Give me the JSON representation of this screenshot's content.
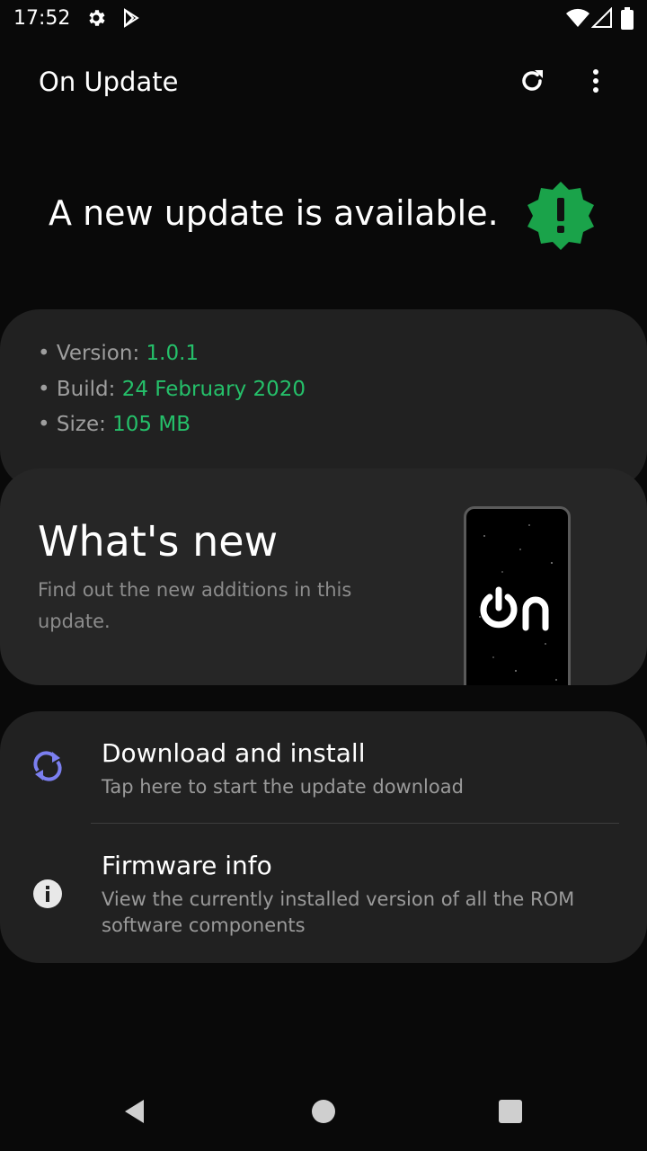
{
  "status_bar": {
    "time": "17:52",
    "icons": [
      "gear-icon",
      "play-store-icon",
      "wifi-icon",
      "signal-icon",
      "battery-icon"
    ]
  },
  "app_bar": {
    "title": "On Update",
    "actions": [
      "refresh-icon",
      "more-vert-icon"
    ]
  },
  "hero": {
    "message": "A new update is available.",
    "badge_icon": "alert-badge-icon",
    "badge_color": "#1aa34a"
  },
  "info": {
    "version_label": "• Version: ",
    "version_value": "1.0.1",
    "build_label": "• Build: ",
    "build_value": "24 February 2020",
    "size_label": "• Size: ",
    "size_value": "105 MB",
    "accent_color": "#25c06a"
  },
  "whats_new": {
    "title": "What's new",
    "description": "Find out the new additions in this update.",
    "logo_icon": "on-logo-icon"
  },
  "actions": [
    {
      "icon": "sync-icon",
      "title": "Download and install",
      "subtitle": "Tap here to start the update download",
      "icon_color": "#7b7ff0"
    },
    {
      "icon": "info-icon",
      "title": "Firmware info",
      "subtitle": "View the currently installed version of all the ROM software components"
    }
  ],
  "nav_bar": {
    "buttons": [
      "back-icon",
      "home-icon",
      "recents-icon"
    ]
  }
}
